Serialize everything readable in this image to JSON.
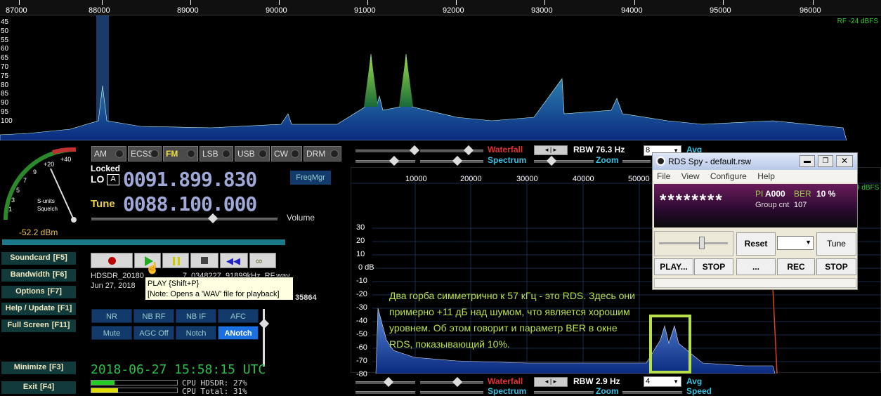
{
  "top_spectrum": {
    "freq_labels": [
      "87000",
      "88000",
      "89000",
      "90000",
      "91000",
      "92000",
      "93000",
      "94000",
      "95000",
      "96000"
    ],
    "db_labels": [
      "45",
      "50",
      "55",
      "60",
      "65",
      "70",
      "75",
      "80",
      "85",
      "90",
      "95",
      "100"
    ],
    "rf_level": "RF -24 dBFS"
  },
  "smeter": {
    "scale_labels": [
      "+40",
      "+20",
      "9",
      "7",
      "5",
      "3",
      "1"
    ],
    "label_sunits": "S-units",
    "label_squelch": "Squelch",
    "level": "-52.2 dBm"
  },
  "modes": [
    "AM",
    "ECSS",
    "FM",
    "LSB",
    "USB",
    "CW",
    "DRM"
  ],
  "active_mode": "FM",
  "lo": {
    "status": "Locked",
    "label": "LO",
    "a_label": "A",
    "value": "0091.899.830"
  },
  "tune": {
    "label": "Tune",
    "value": "0088.100.000"
  },
  "freqmgr_label": "FreqMgr",
  "volume_label": "Volume",
  "left_buttons": [
    {
      "label": "Soundcard",
      "key": "[F5]"
    },
    {
      "label": "Bandwidth",
      "key": "[F6]"
    },
    {
      "label": "Options",
      "key": "[F7]"
    },
    {
      "label": "Help / Update",
      "key": "[F1]"
    },
    {
      "label": "Full Screen",
      "key": "[F11]"
    },
    {
      "label": "Minimize",
      "key": "[F3]"
    },
    {
      "label": "Exit",
      "key": "[F4]"
    }
  ],
  "file_info": {
    "line1": "HDSDR_20180",
    "line1_tail": "7_0348227_91899kHz_RF.wav",
    "line2": "Jun 27, 2018",
    "line2_tail": "35864"
  },
  "tooltip": {
    "line1": "PLAY {Shift+P}",
    "line2": "[Note: Opens a 'WAV' file for playback]"
  },
  "dsp_buttons": [
    "NR",
    "NB RF",
    "NB IF",
    "AFC",
    "Mute",
    "AGC Off",
    "Notch",
    "ANotch"
  ],
  "datetime": "2018-06-27   15:58:15 UTC",
  "cpu": {
    "hdsdr": "CPU HDSDR:  27%",
    "total": "CPU Total:  31%"
  },
  "top_controls": {
    "waterfall": "Waterfall",
    "spectrum": "Spectrum",
    "zoom": "Zoom",
    "rbw": "RBW  76.3 Hz",
    "avg_value": "8",
    "avg": "Avg"
  },
  "audio_spectrum": {
    "freq_labels": [
      "10000",
      "20000",
      "30000",
      "40000",
      "50000"
    ],
    "db_labels": [
      "30",
      "20",
      "10",
      "0 dB",
      "-10",
      "-20",
      "-30",
      "-40",
      "-50",
      "-60",
      "-70",
      "-80"
    ],
    "rf_level": "9 dBFS"
  },
  "bottom_controls": {
    "waterfall": "Waterfall",
    "spectrum": "Spectrum",
    "zoom": "Zoom",
    "rbw": "RBW  2.9 Hz",
    "avg_value": "4",
    "avg": "Avg",
    "speed": "Speed"
  },
  "rds_window": {
    "title": "RDS Spy - default.rsw",
    "menu": [
      "File",
      "View",
      "Configure",
      "Help"
    ],
    "ps": "********",
    "pi_label": "PI",
    "pi_value": "A000",
    "ber_label": "BER",
    "ber_value": "10 %",
    "group_label": "Group cnt",
    "group_value": "107",
    "btn_reset": "Reset",
    "btn_tune": "Tune",
    "btn_play": "PLAY...",
    "btn_stop1": "STOP",
    "btn_dots": "...",
    "btn_rec": "REC",
    "btn_stop2": "STOP"
  },
  "annotation": "Два горба симметрично к 57 кГц - это RDS. Здесь они примерно +11 дБ над шумом, что является хорошим уровнем. Об этом говорит и параметр BER в окне RDS, показывающий 10%."
}
